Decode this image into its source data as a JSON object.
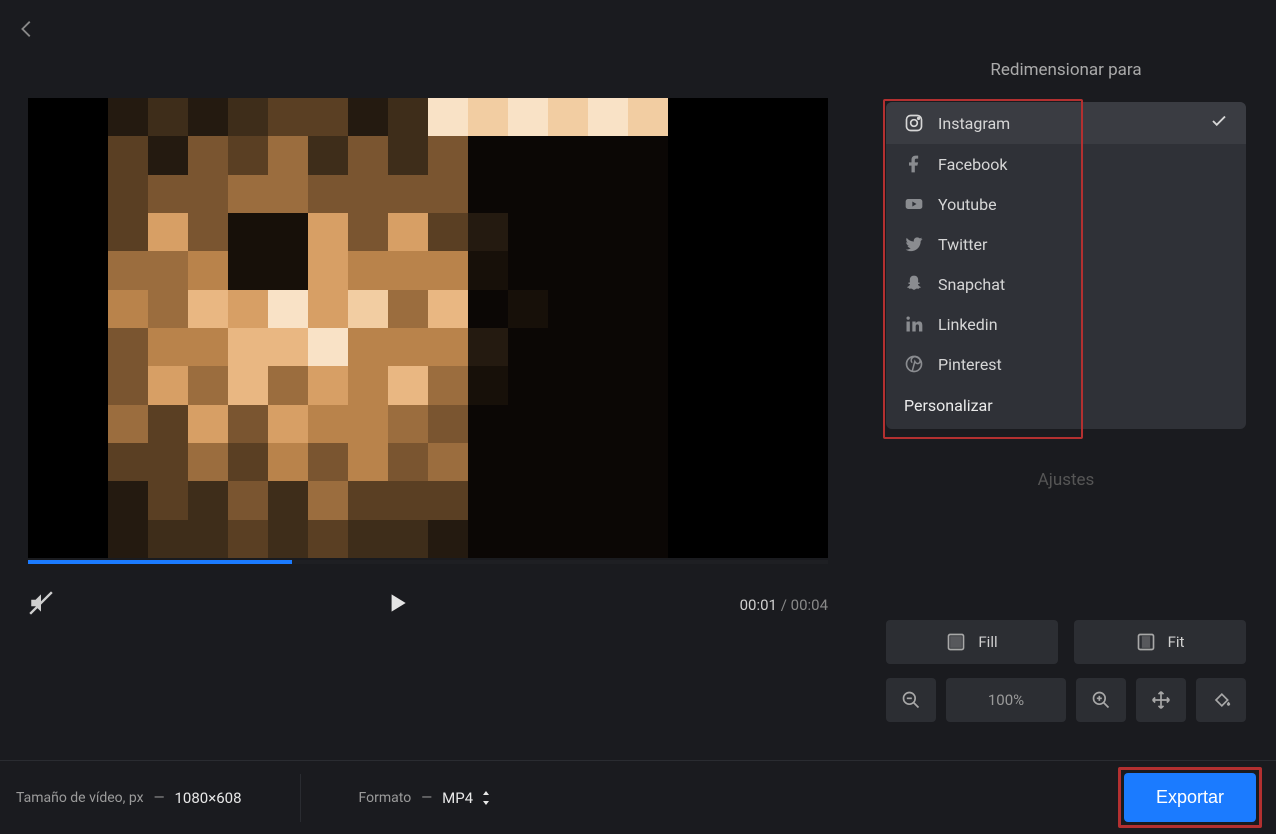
{
  "sidebar": {
    "title": "Redimensionar para",
    "options": [
      {
        "label": "Instagram"
      },
      {
        "label": "Facebook"
      },
      {
        "label": "Youtube"
      },
      {
        "label": "Twitter"
      },
      {
        "label": "Snapchat"
      },
      {
        "label": "Linkedin"
      },
      {
        "label": "Pinterest"
      }
    ],
    "custom_label": "Personalizar",
    "ajustes_label": "Ajustes",
    "fill_label": "Fill",
    "fit_label": "Fit",
    "zoom_label": "100%"
  },
  "player": {
    "current_time": "00:01",
    "total_time": "00:04",
    "progress_percent": 33
  },
  "bottombar": {
    "size_label": "Tamaño de vídeo, px",
    "size_sep": "—",
    "size_value": "1080×608",
    "format_label": "Formato",
    "format_sep": "—",
    "format_value": "MP4",
    "export_label": "Exportar"
  }
}
